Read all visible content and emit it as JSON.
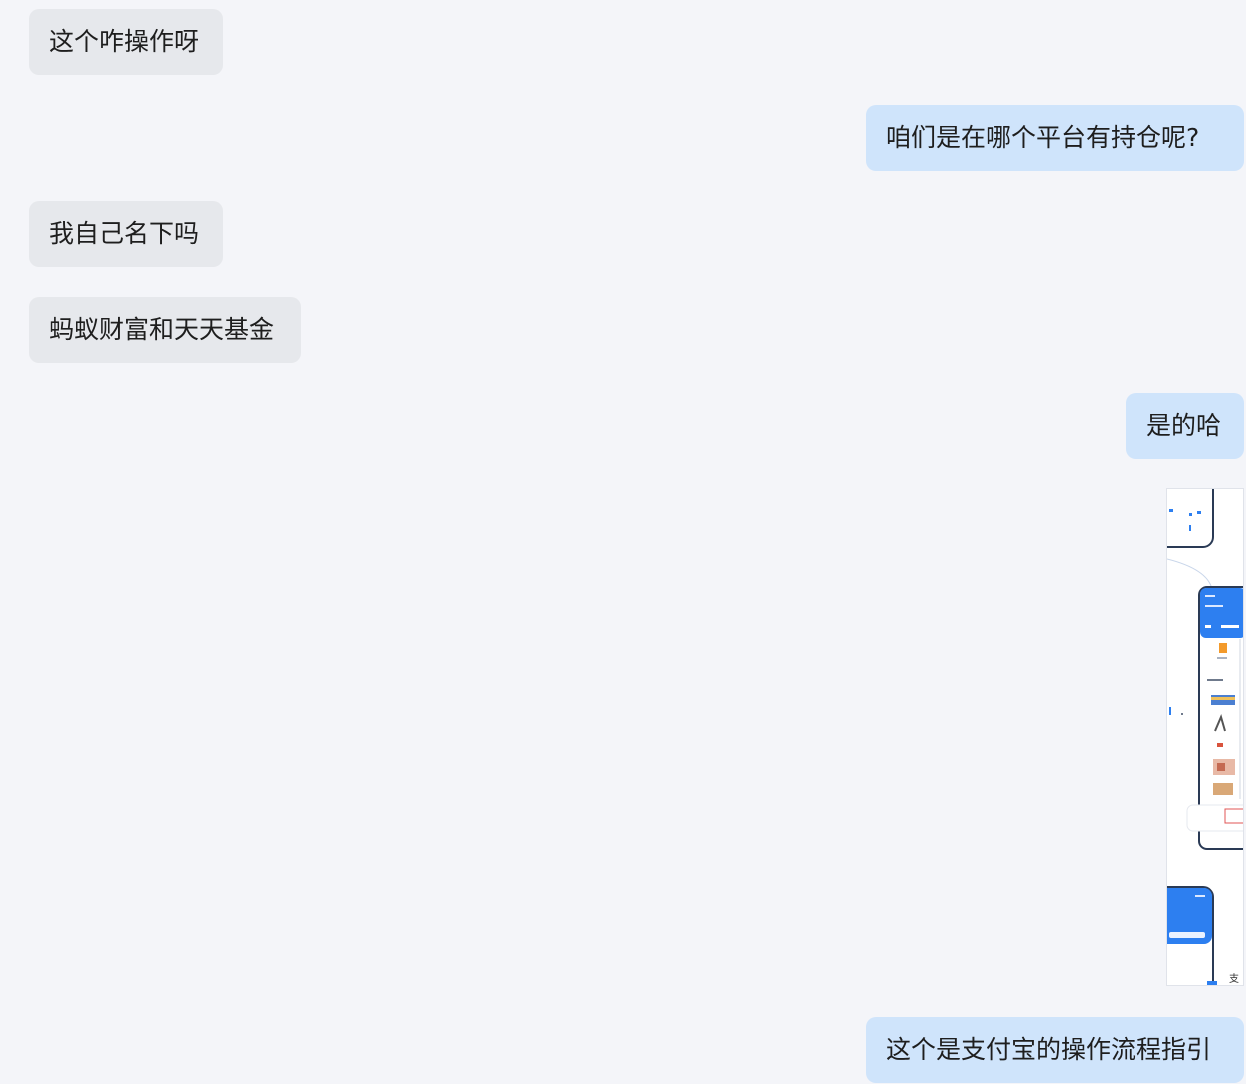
{
  "messages": [
    {
      "side": "left",
      "text": "这个咋操作呀"
    },
    {
      "side": "right",
      "text": "咱们是在哪个平台有持仓呢?"
    },
    {
      "side": "left",
      "text": "我自己名下吗"
    },
    {
      "side": "left",
      "text": "蚂蚁财富和天天基金"
    },
    {
      "side": "right",
      "text": "是的哈"
    },
    {
      "side": "right",
      "type": "image",
      "caption": "支"
    },
    {
      "side": "right",
      "text": "这个是支付宝的操作流程指引"
    }
  ],
  "colors": {
    "background": "#f4f5f9",
    "left_bubble": "#e6e8ec",
    "right_bubble": "#cfe4fb",
    "accent_blue": "#2d7ff0",
    "text": "#1e1e1e"
  }
}
